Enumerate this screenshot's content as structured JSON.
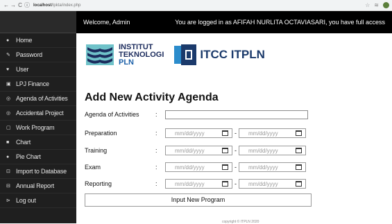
{
  "browser": {
    "url_host": "localhost",
    "url_path": "/lpkta/index.php"
  },
  "sidebar": {
    "items": [
      {
        "icon": "home-icon",
        "glyph": "●",
        "label": "Home"
      },
      {
        "icon": "key-icon",
        "glyph": "✎",
        "label": "Password"
      },
      {
        "icon": "user-icon",
        "glyph": "♥",
        "label": "User"
      },
      {
        "icon": "document-icon",
        "glyph": "▣",
        "label": "LPJ Finance"
      },
      {
        "icon": "eye-icon",
        "glyph": "◎",
        "label": "Agenda of Activities"
      },
      {
        "icon": "eye-icon",
        "glyph": "◎",
        "label": "Accidental Project"
      },
      {
        "icon": "document-icon",
        "glyph": "▢",
        "label": "Work Program"
      },
      {
        "icon": "chart-icon",
        "glyph": "■",
        "label": "Chart"
      },
      {
        "icon": "pie-icon",
        "glyph": "●",
        "label": "Pie Chart"
      },
      {
        "icon": "database-icon",
        "glyph": "⊡",
        "label": "Import to Database"
      },
      {
        "icon": "print-icon",
        "glyph": "⊟",
        "label": "Annual Report"
      },
      {
        "icon": "logout-icon",
        "glyph": "⊳",
        "label": "Log out"
      }
    ]
  },
  "topbar": {
    "welcome": "Welcome, Admin",
    "status": "You are logged in as AFIFAH NURLITA OCTAVIASARI, you have full access"
  },
  "logos": {
    "inst_line1": "INSTITUT",
    "inst_line2": "TEKNOLOGI",
    "inst_line3": "PLN",
    "itcc": "ITCC ITPLN"
  },
  "form": {
    "title": "Add New Activity Agenda",
    "colon": ":",
    "date_placeholder": "mm/dd/yyyy",
    "range_sep": "-",
    "activities_label": "Agenda of Activities",
    "fields": [
      {
        "label": "Preparation"
      },
      {
        "label": "Training"
      },
      {
        "label": "Exam"
      },
      {
        "label": "Reporting"
      }
    ],
    "submit_label": "Input New Program"
  },
  "footer": {
    "text": "copyright © ITPLN 2020"
  }
}
